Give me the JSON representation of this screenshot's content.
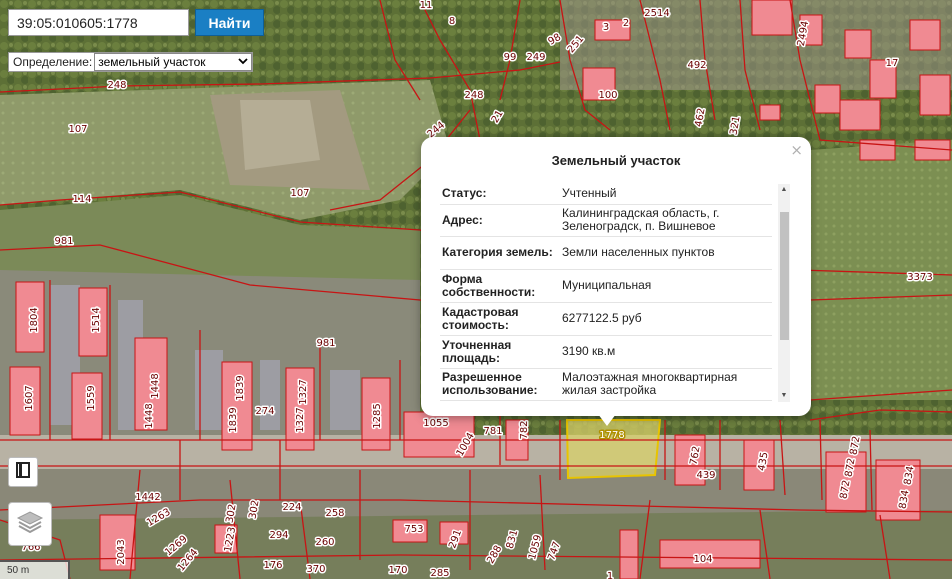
{
  "search": {
    "value": "39:05:010605:1778",
    "button": "Найти"
  },
  "define": {
    "label": "Определение:",
    "selected": "земельный участок"
  },
  "popup": {
    "title": "Земельный участок",
    "close": "×",
    "rows": [
      {
        "key": "Статус:",
        "value": "Учтенный"
      },
      {
        "key": "Адрес:",
        "value": "Калининградская область, г. Зеленоградск, п. Вишневое"
      },
      {
        "key": "Категория земель:",
        "value": "Земли населенных пунктов"
      },
      {
        "key": "Форма собственности:",
        "value": "Муниципальная"
      },
      {
        "key": "Кадастровая стоимость:",
        "value": "6277122.5 руб"
      },
      {
        "key": "Уточненная площадь:",
        "value": "3190 кв.м"
      },
      {
        "key": "Разрешенное использование:",
        "value": "Малоэтажная многоквартирная жилая застройка"
      }
    ]
  },
  "scale": {
    "label": "50 m"
  },
  "map": {
    "selected_plot": "1778",
    "plot_labels": [
      "11",
      "8",
      "2514",
      "3",
      "2",
      "98",
      "99",
      "249",
      "251",
      "492",
      "17",
      "2494",
      "248",
      "100",
      "248",
      "21",
      "462",
      "321",
      "244",
      "107",
      "107",
      "114",
      "981",
      "3373",
      "1804",
      "1514",
      "1448",
      "1448",
      "1607",
      "1559",
      "1839",
      "1839",
      "274",
      "1327",
      "1327",
      "1285",
      "981",
      "1055",
      "1004",
      "781",
      "782",
      "762",
      "435",
      "439",
      "872",
      "872",
      "872",
      "834",
      "834",
      "1442",
      "1263",
      "1269",
      "1264",
      "2043",
      "302",
      "302",
      "224",
      "258",
      "294",
      "260",
      "1223",
      "753",
      "291",
      "831",
      "288",
      "1059",
      "747",
      "766",
      "176",
      "370",
      "170",
      "285",
      "104",
      "1"
    ],
    "colors": {
      "boundary": "#c81414",
      "building": "#f08a92",
      "selected_fill": "#d8d06a",
      "selected_stroke": "#e8c400"
    }
  },
  "icons": {
    "bookmark": "bookmark-icon",
    "layers": "layers-icon"
  }
}
